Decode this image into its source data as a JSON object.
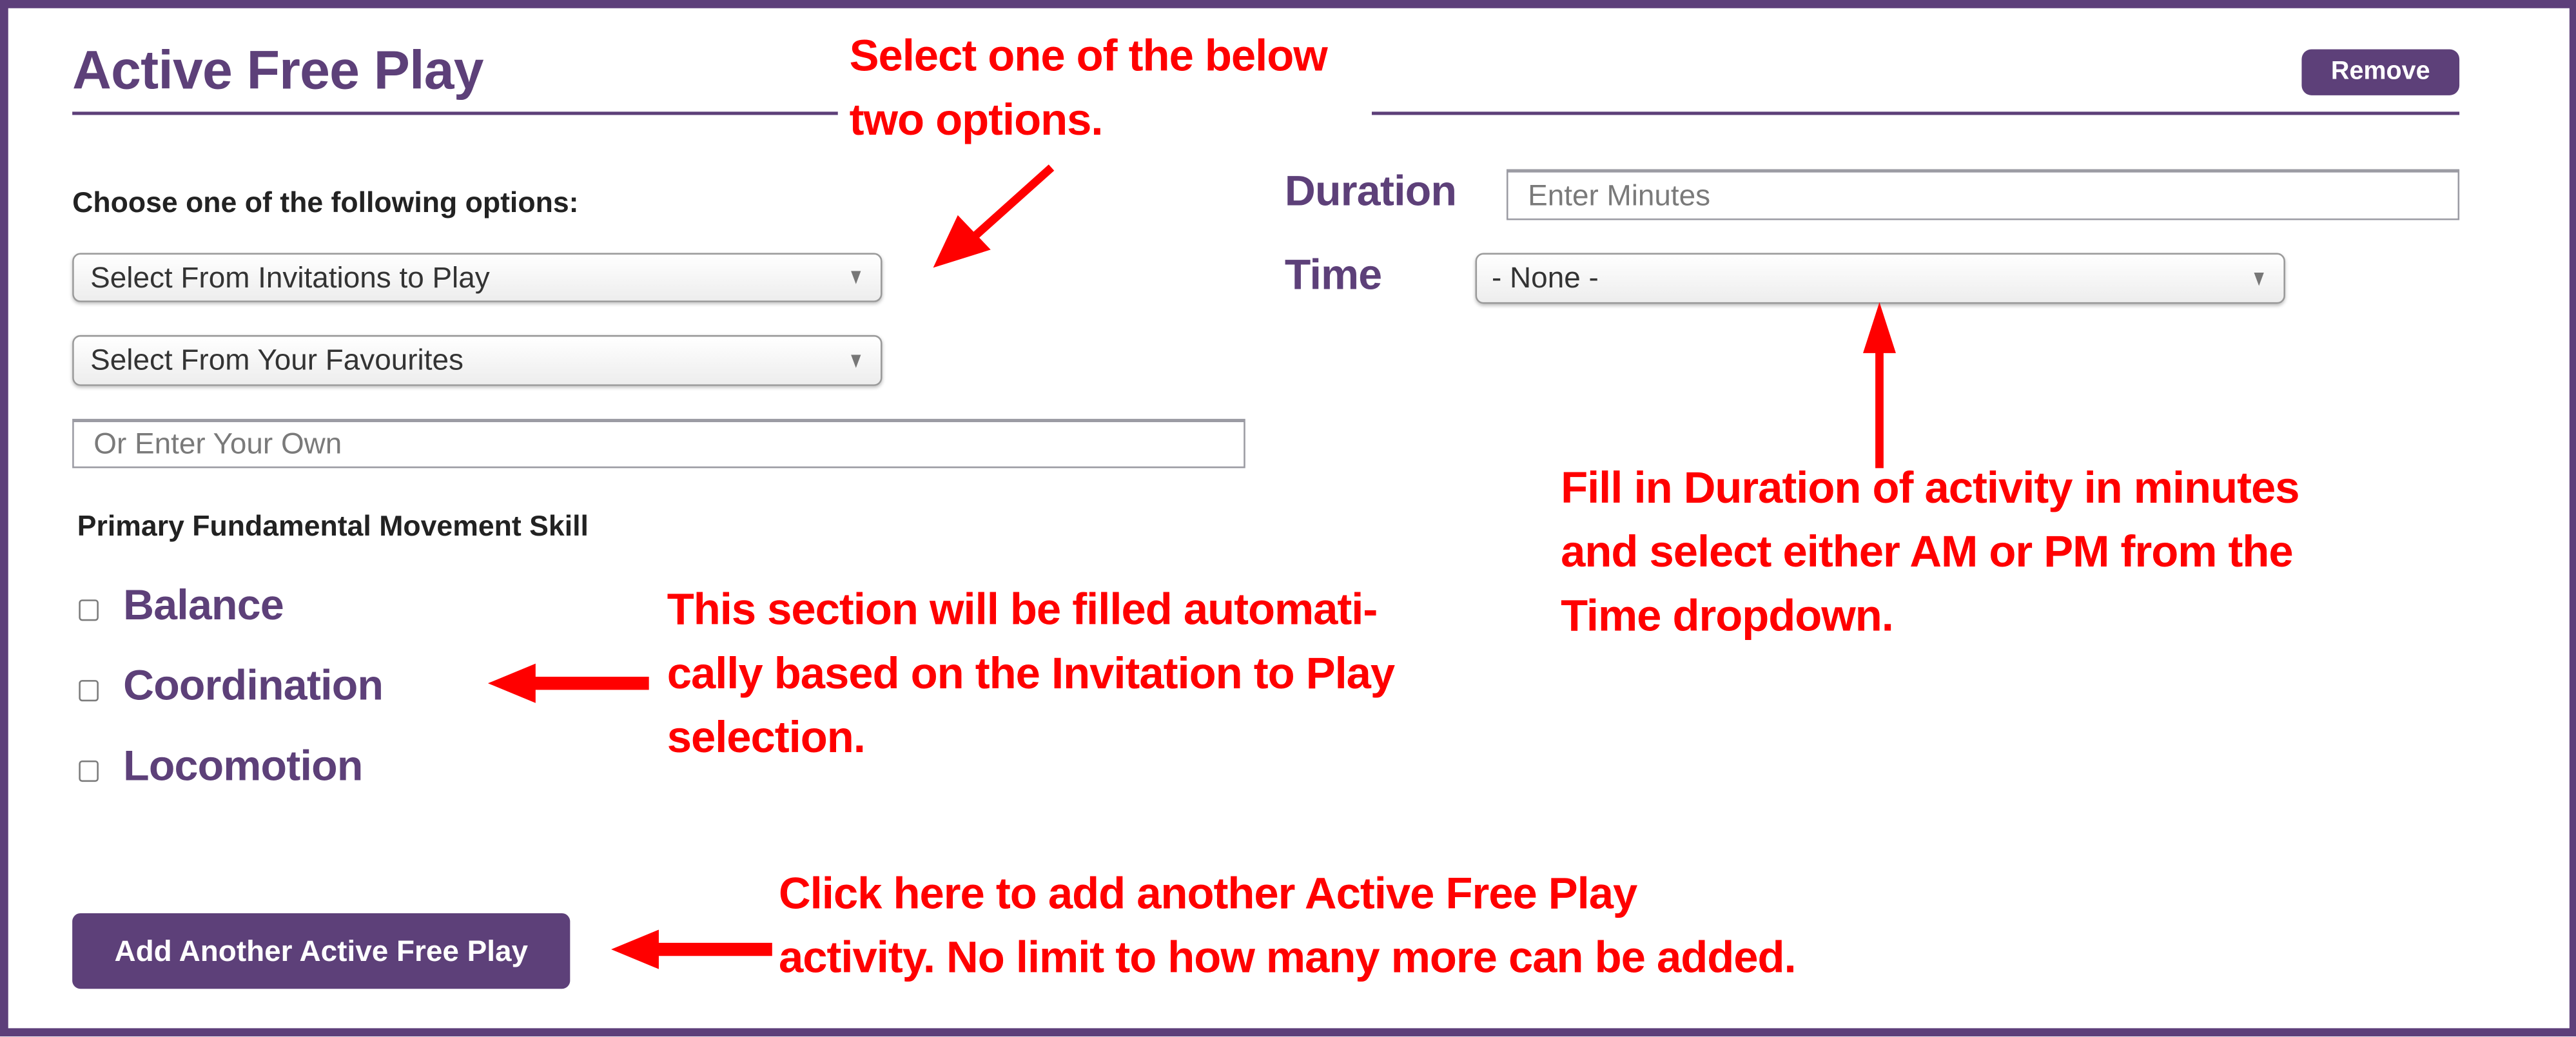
{
  "section": {
    "title": "Active Free Play",
    "remove_label": "Remove",
    "accent_color": "#5d4079"
  },
  "activity_options": {
    "instruction": "Choose one of the following options:",
    "invitations_select": {
      "selected": "Select From Invitations to Play"
    },
    "favourites_select": {
      "selected": "Select From Your Favourites"
    },
    "own_input": {
      "value": "",
      "placeholder": "Or Enter Your Own"
    }
  },
  "duration": {
    "label": "Duration",
    "input": {
      "value": "",
      "placeholder": "Enter Minutes"
    }
  },
  "time": {
    "label": "Time",
    "select": {
      "selected": "- None -"
    }
  },
  "fms": {
    "heading": "Primary Fundamental Movement Skill",
    "options": [
      {
        "label": "Balance",
        "checked": false
      },
      {
        "label": "Coordination",
        "checked": false
      },
      {
        "label": "Locomotion",
        "checked": false
      }
    ]
  },
  "add_button_label": "Add Another Active Free Play",
  "annotations": {
    "color": "#ff0000",
    "select_options": [
      "Select one of the below",
      "two options."
    ],
    "duration_time": [
      "Fill in Duration of activity in minutes",
      "and select either AM or PM from the",
      "Time dropdown."
    ],
    "fms_auto": [
      "This section will be filled  automati-",
      "cally based on the Invitation to Play",
      "selection."
    ],
    "add_another": [
      "Click here to add another Active Free Play",
      "activity.  No limit to how many more can be added."
    ]
  }
}
